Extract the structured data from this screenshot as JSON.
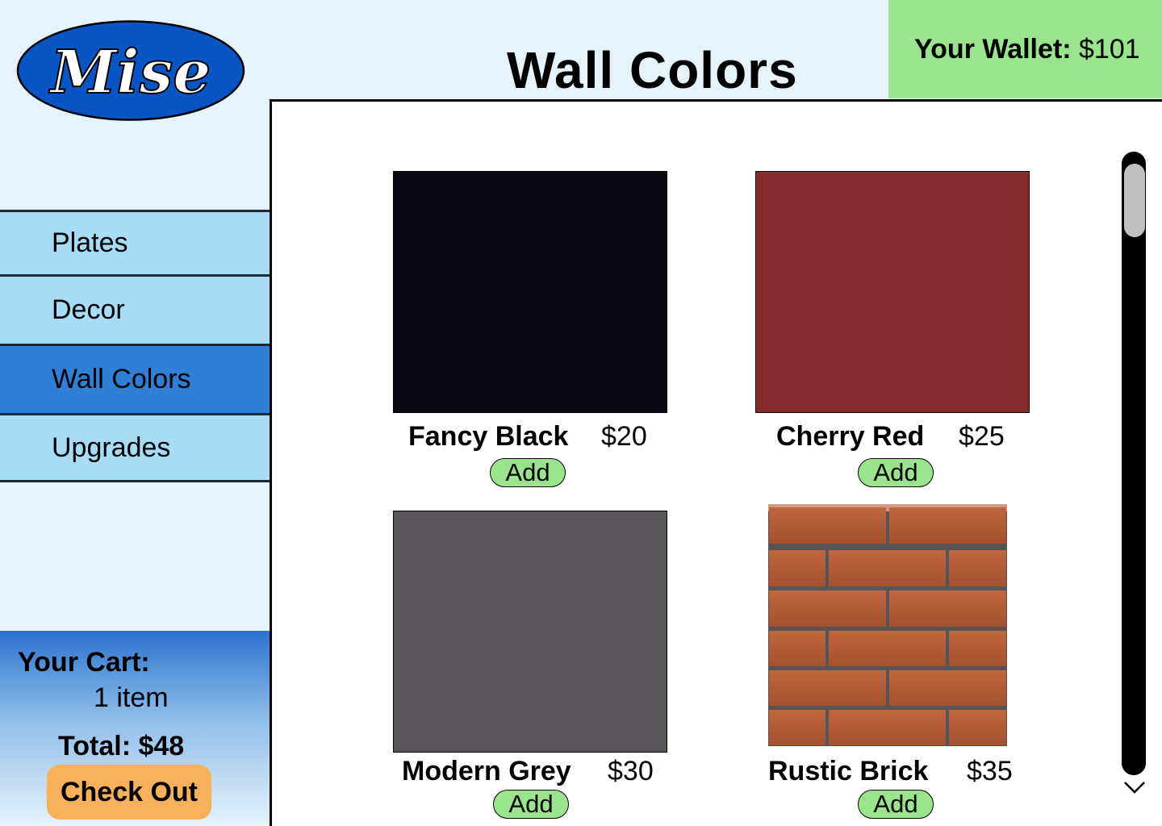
{
  "logo": {
    "text": "Mise"
  },
  "header": {
    "title": "Wall Colors"
  },
  "wallet": {
    "label": "Your Wallet:",
    "amount": "$101"
  },
  "sidebar": {
    "items": [
      {
        "label": "Plates"
      },
      {
        "label": "Decor"
      },
      {
        "label": "Wall Colors"
      },
      {
        "label": "Upgrades"
      }
    ],
    "active": "Wall Colors"
  },
  "cart": {
    "title": "Your Cart:",
    "items": "1 item",
    "total": "Total: $48",
    "checkout_label": "Check Out"
  },
  "products": [
    {
      "name": "Fancy Black",
      "price": "$20",
      "add_label": "Add",
      "color": "#080912"
    },
    {
      "name": "Cherry Red",
      "price": "$25",
      "add_label": "Add",
      "color": "#852b2c"
    },
    {
      "name": "Modern Grey",
      "price": "$30",
      "add_label": "Add",
      "color": "#5a555c"
    },
    {
      "name": "Rustic Brick",
      "price": "$35",
      "add_label": "Add",
      "color": "#b45f3f"
    }
  ],
  "icons": {
    "scroll_down": "chevron-down-icon"
  },
  "colors": {
    "background": "#e4f3fc",
    "nav": "#a7dcf7",
    "nav_active": "#2f7fd6",
    "wallet": "#9be48e",
    "checkout": "#f7b15c",
    "logo_blue": "#0a55c4"
  }
}
